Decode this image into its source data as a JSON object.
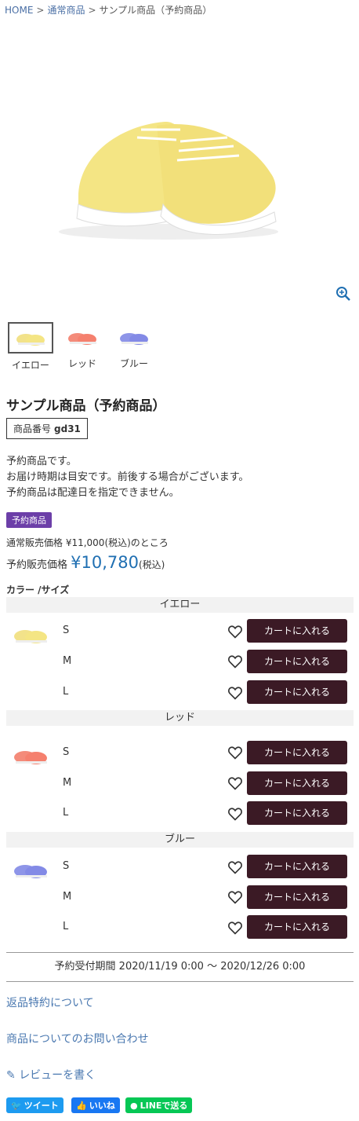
{
  "breadcrumb": {
    "home": "HOME",
    "cat": "通常商品",
    "current": "サンプル商品（予約商品）",
    "sep": ">"
  },
  "thumbnails": [
    {
      "label": "イエロー",
      "color": "#f2e28a"
    },
    {
      "label": "レッド",
      "color": "#f48b7a"
    },
    {
      "label": "ブルー",
      "color": "#8e95e8"
    }
  ],
  "product": {
    "title": "サンプル商品（予約商品）",
    "code_label": "商品番号",
    "code": "gd31",
    "desc1": "予約商品です。",
    "desc2": "お届け時期は目安です。前後する場合がございます。",
    "desc3": "予約商品は配達日を指定できません。",
    "badge": "予約商品",
    "normal_price": "通常販売価格 ¥11,000(税込)のところ",
    "sale_label": "予約販売価格",
    "sale_amount": "¥10,780",
    "sale_tax": "(税込)"
  },
  "variants_label": "カラー /サイズ",
  "groups": [
    {
      "name": "イエロー",
      "sizes": [
        "S",
        "M",
        "L"
      ]
    },
    {
      "name": "レッド",
      "sizes": [
        "S",
        "M",
        "L"
      ]
    },
    {
      "name": "ブルー",
      "sizes": [
        "S",
        "M",
        "L"
      ]
    }
  ],
  "cart_label": "カートに入れる",
  "period": "予約受付期間 2020/11/19 0:00 ～ 2020/12/26 0:00",
  "links": {
    "returns": "返品特約について",
    "inquiry": "商品についてのお問い合わせ",
    "review": "レビューを書く"
  },
  "social": {
    "tweet": "ツイート",
    "like": "いいね",
    "line": "LINEで送る"
  },
  "colors": {
    "accent": "#1f6fb2",
    "cart": "#3b1a25",
    "badge": "#6c3fa8",
    "link": "#4a78b0"
  }
}
